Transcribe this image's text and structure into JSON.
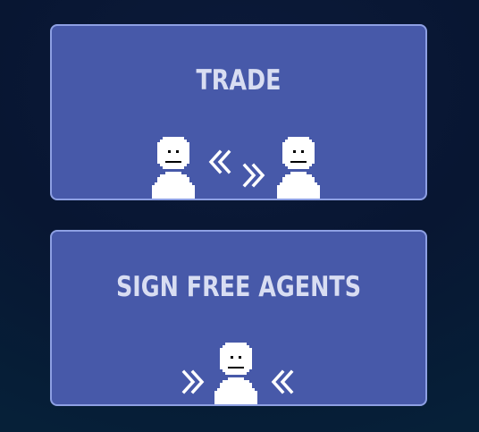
{
  "menu": {
    "trade": {
      "label": "TRADE",
      "icons": [
        "person-icon",
        "chevron-left-double-icon",
        "chevron-right-double-icon",
        "person-icon"
      ]
    },
    "sign_free_agents": {
      "label": "SIGN FREE AGENTS",
      "icons": [
        "chevron-right-double-icon",
        "person-icon",
        "chevron-left-double-icon"
      ]
    }
  },
  "colors": {
    "background": "#081632",
    "card_fill": "#4759a9",
    "card_border": "#8ea0e3",
    "label_text": "#d8ddf2",
    "icon_fill": "#ffffff"
  }
}
